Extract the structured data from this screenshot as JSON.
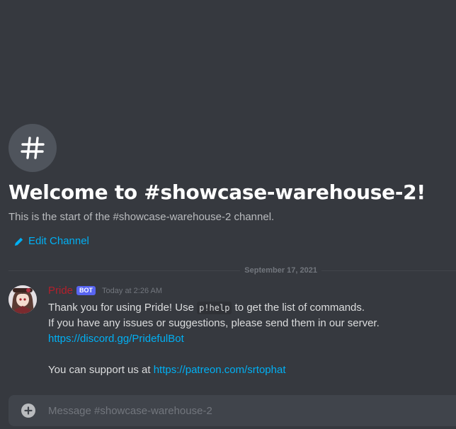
{
  "channel": {
    "name": "showcase-warehouse-2",
    "icon": "hash-icon",
    "welcome_title": "Welcome to #showcase-warehouse-2!",
    "welcome_subtitle": "This is the start of the #showcase-warehouse-2 channel.",
    "edit_label": "Edit Channel"
  },
  "divider": {
    "date": "September 17, 2021"
  },
  "message": {
    "author": "Pride",
    "author_color": "#b3202c",
    "badge": "BOT",
    "timestamp": "Today at 2:26 AM",
    "line1_prefix": "Thank you for using Pride! Use ",
    "line1_code": "p!help",
    "line1_suffix": " to get the list of commands.",
    "line2": "If you have any issues or suggestions, please send them in our server.",
    "server_link": "https://discord.gg/PridefulBot",
    "support_prefix": "You can support us at ",
    "support_link": "https://patreon.com/srtophat"
  },
  "composer": {
    "placeholder": "Message #showcase-warehouse-2",
    "attach_icon": "plus-circle-icon"
  },
  "colors": {
    "background": "#36393f",
    "link": "#00b0f4",
    "bot_badge": "#5865f2"
  }
}
